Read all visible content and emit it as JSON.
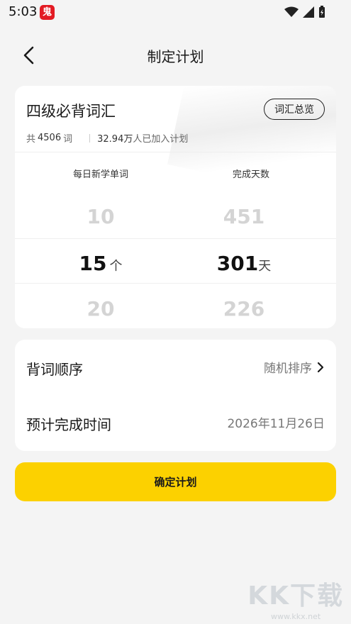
{
  "status_bar": {
    "time": "5:03",
    "badge_text": "鬼"
  },
  "header": {
    "title": "制定计划",
    "back_icon": "chevron-left-icon"
  },
  "book": {
    "title": "四级必背词汇",
    "overview_label": "词汇总览",
    "count_prefix": "共",
    "count_value": "4506",
    "count_suffix": "词",
    "joined_value": "32.94万",
    "joined_suffix": "人已加入计划"
  },
  "picker": {
    "left_label": "每日新学单词",
    "right_label": "完成天数",
    "left_values": [
      "10",
      "15",
      "20"
    ],
    "right_values": [
      "451",
      "301",
      "226"
    ],
    "left_unit": "个",
    "right_unit": "天"
  },
  "settings": {
    "order_label": "背词顺序",
    "order_value": "随机排序",
    "finish_label": "预计完成时间",
    "finish_value": "2026年11月26日"
  },
  "confirm_label": "确定计划",
  "watermark": {
    "logo": "KK下载",
    "url": "www.kkx.net"
  },
  "colors": {
    "accent": "#fcd100",
    "background": "#f4f4f4",
    "badge": "#e31b23"
  }
}
